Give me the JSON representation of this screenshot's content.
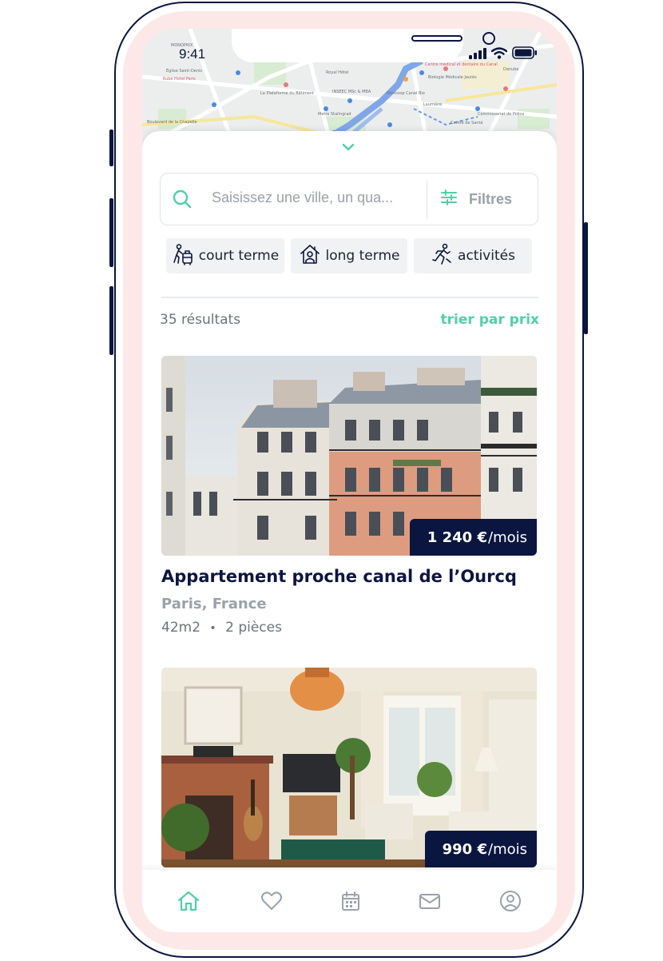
{
  "status_bar": {
    "time": "9:41"
  },
  "map": {
    "labels": [
      "MONOPRIX",
      "Église Saint-Denis",
      "Kube Hotel Paris",
      "Boulevard de la Chapelle",
      "La Plateforme du Bâtiment",
      "Royal Hôtel",
      "INSEEC MSc & MBA",
      "Metro Stalingrad",
      "Moncoop Canal Bio",
      "Laumière",
      "Centre médical et dentaire du Canal",
      "Biologie Médicale Jaurès",
      "Commissariat de Police",
      "Centre de Santé",
      "Danube"
    ]
  },
  "search": {
    "placeholder": "Saisissez une ville, un qua...",
    "filters_label": "Filtres"
  },
  "chips": [
    {
      "label": "court terme",
      "icon": "luggage-person-icon"
    },
    {
      "label": "long terme",
      "icon": "house-person-icon"
    },
    {
      "label": "activités",
      "icon": "running-person-icon"
    }
  ],
  "results": {
    "count_label": "35 résultats",
    "sort_label": "trier par prix"
  },
  "listings": [
    {
      "price": "1 240 €",
      "price_unit": "/mois",
      "title": "Appartement proche canal de l’Ourcq",
      "location": "Paris, France",
      "area": "42m2",
      "separator": "•",
      "rooms": "2 pièces"
    },
    {
      "price": "990 €",
      "price_unit": "/mois"
    }
  ],
  "nav": [
    {
      "icon": "home-icon",
      "active": true
    },
    {
      "icon": "heart-icon",
      "active": false
    },
    {
      "icon": "calendar-icon",
      "active": false
    },
    {
      "icon": "mail-icon",
      "active": false
    },
    {
      "icon": "profile-icon",
      "active": false
    }
  ],
  "colors": {
    "accent": "#4fd1a5",
    "navy": "#0b1640",
    "frame_pink": "#fde8e8",
    "muted": "#9aa1a9"
  }
}
